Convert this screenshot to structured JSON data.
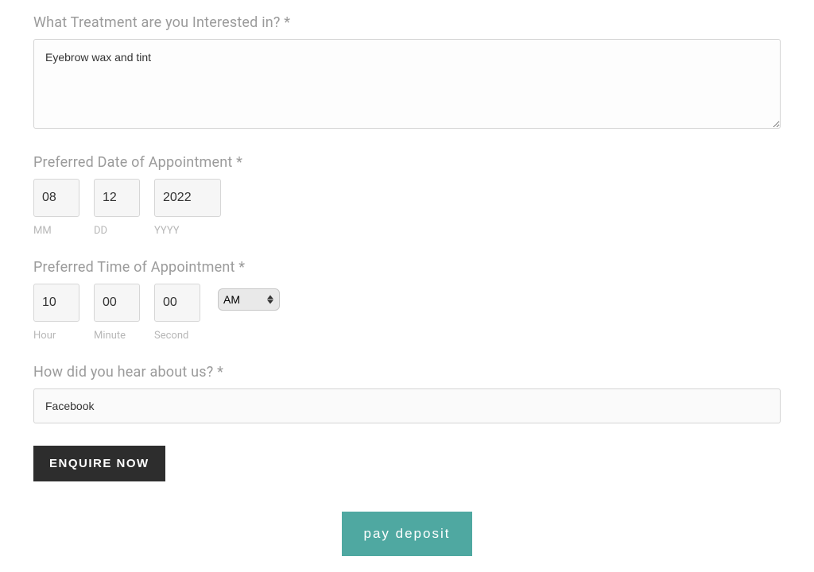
{
  "treatment": {
    "label": "What Treatment are you Interested in? *",
    "value": "Eyebrow wax and tint"
  },
  "date": {
    "label": "Preferred Date of Appointment *",
    "mm": {
      "value": "08",
      "sublabel": "MM"
    },
    "dd": {
      "value": "12",
      "sublabel": "DD"
    },
    "yyyy": {
      "value": "2022",
      "sublabel": "YYYY"
    }
  },
  "time": {
    "label": "Preferred Time of Appointment *",
    "hour": {
      "value": "10",
      "sublabel": "Hour"
    },
    "minute": {
      "value": "00",
      "sublabel": "Minute"
    },
    "second": {
      "value": "00",
      "sublabel": "Second"
    },
    "ampm": {
      "value": "AM"
    }
  },
  "hear": {
    "label": "How did you hear about us? *",
    "value": "Facebook"
  },
  "buttons": {
    "enquire": "ENQUIRE NOW",
    "pay_deposit": "pay deposit"
  }
}
